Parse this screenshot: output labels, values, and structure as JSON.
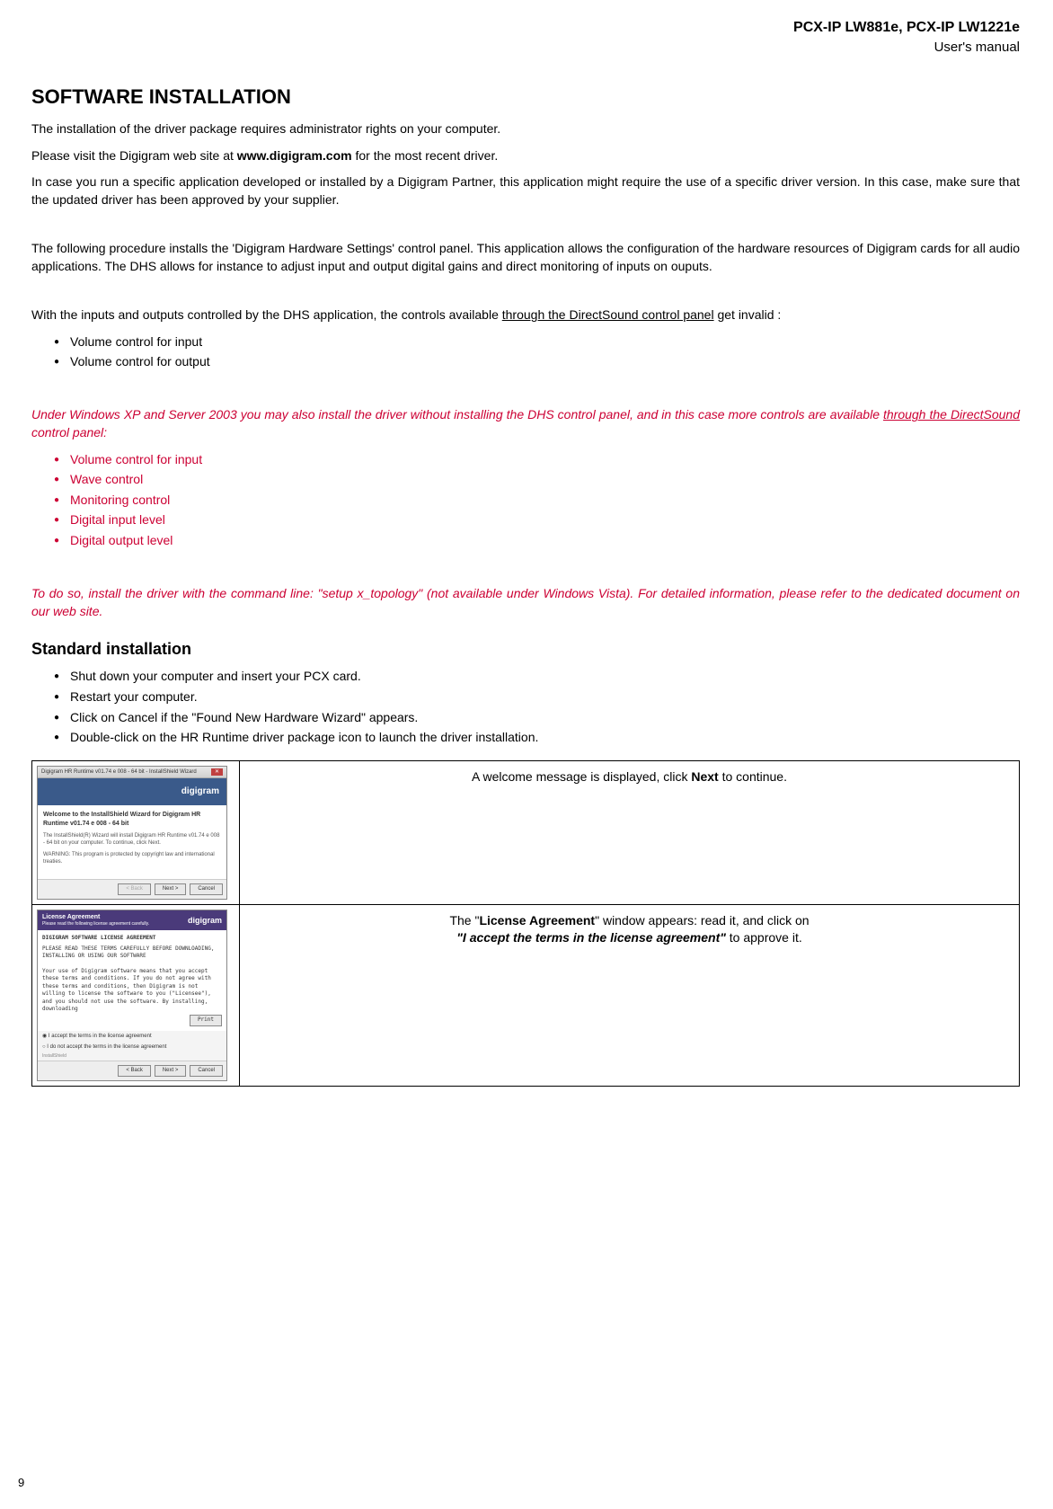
{
  "header": {
    "title": "PCX-IP LW881e, PCX-IP LW1221e",
    "subtitle": "User's manual"
  },
  "h1": "SOFTWARE INSTALLATION",
  "p1": "The installation of the driver package requires administrator rights on your computer.",
  "p2_a": "Please visit the Digigram web site at ",
  "p2_b": "www.digigram.com",
  "p2_c": " for the most recent driver.",
  "p3": "In case you run a specific application developed or installed by a Digigram Partner, this application might require the use of a specific driver version. In this case, make sure that the updated driver has been approved by your supplier.",
  "p4": "The following procedure installs the 'Digigram Hardware Settings' control panel. This application allows the configuration of the hardware resources of Digigram cards for all audio applications. The DHS allows for instance to adjust input and output digital gains and direct monitoring of inputs on ouputs.",
  "p5_a": "With the inputs and outputs controlled by the DHS application, the controls available ",
  "p5_u": "through the DirectSound control panel",
  "p5_b": " get invalid :",
  "list1": {
    "i1": "Volume control for input",
    "i2": "Volume control for output"
  },
  "red_p1_a": "Under Windows XP and Server 2003 you may also install the driver without installing the DHS control panel, and in this case more controls are available ",
  "red_p1_u": "through the DirectSound",
  "red_p1_b": " control panel:",
  "list2": {
    "i1": "Volume control for input",
    "i2": "Wave control",
    "i3": "Monitoring control",
    "i4": "Digital input level",
    "i5": "Digital output level"
  },
  "red_p2": "To do so, install the driver with the command line: \"setup x_topology\" (not available under Windows Vista). For detailed information, please refer to the dedicated document on our web site.",
  "h2": "Standard installation",
  "list3": {
    "i1": "Shut down your computer and insert your PCX card.",
    "i2": "Restart your computer.",
    "i3": "Click on Cancel if the \"Found New Hardware Wizard\" appears.",
    "i4": "Double-click on the HR Runtime driver package icon to launch the driver installation."
  },
  "table": {
    "row1": {
      "wizard_title": "Digigram HR Runtime v01.74 e 008 - 64 bit - InstallShield Wizard",
      "banner": "digigram",
      "welcome": "Welcome to the InstallShield Wizard for Digigram HR Runtime v01.74 e 008 - 64 bit",
      "body1": "The InstallShield(R) Wizard will install Digigram HR Runtime v01.74 e 008 - 64 bit on your computer. To continue, click Next.",
      "body2": "WARNING: This program is protected by copyright law and international treaties.",
      "btn_back": "< Back",
      "btn_next": "Next >",
      "btn_cancel": "Cancel",
      "desc_a": "A welcome message is displayed, click ",
      "desc_b": "Next",
      "desc_c": " to continue."
    },
    "row2": {
      "lic_header_a": "License Agreement",
      "lic_header_b": "Please read the following license agreement carefully.",
      "banner": "digigram",
      "lic_title": "DIGIGRAM SOFTWARE LICENSE AGREEMENT",
      "lic_text": "PLEASE READ THESE TERMS CAREFULLY BEFORE DOWNLOADING, INSTALLING OR USING OUR SOFTWARE\n\nYour use of Digigram software means that you accept these terms and conditions. If you do not agree with these terms and conditions, then Digigram is not willing to license the software to you (\"Licensee\"), and you should not use the software. By installing, downloading",
      "radio1": "I accept the terms in the license agreement",
      "radio2": "I do not accept the terms in the license agreement",
      "btn_print": "Print",
      "btn_back": "< Back",
      "btn_next": "Next >",
      "btn_cancel": "Cancel",
      "shield": "InstallShield",
      "desc_a": "The \"",
      "desc_b": "License Agreement",
      "desc_c": "\" window appears: read it, and click on",
      "desc_d": "\"I accept the terms in the license agreement\"",
      "desc_e": " to approve it."
    }
  },
  "page_num": "9"
}
